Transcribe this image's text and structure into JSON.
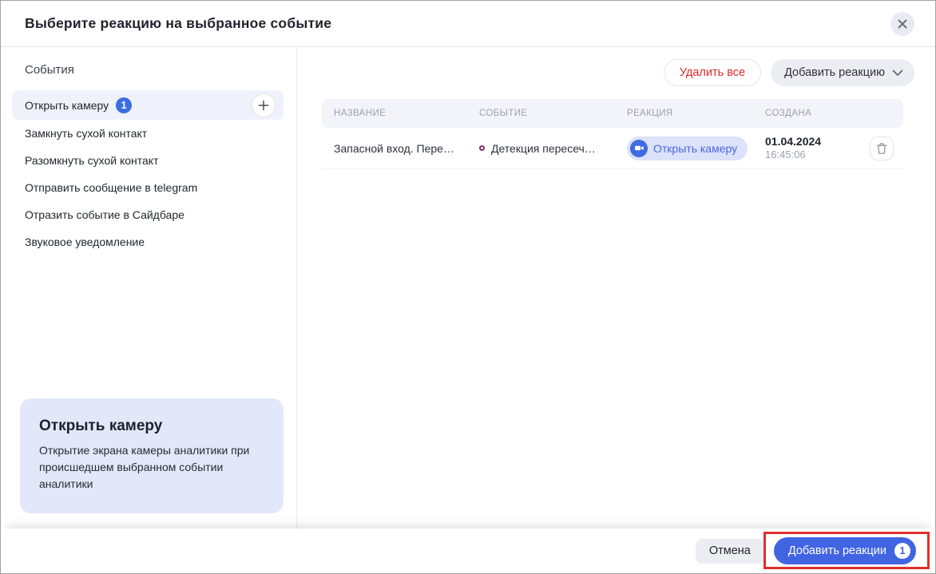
{
  "dialog": {
    "title": "Выберите реакцию на выбранное событие"
  },
  "sidebar": {
    "heading": "События",
    "items": [
      {
        "label": "Открыть камеру",
        "badge": "1",
        "selected": true
      },
      {
        "label": "Замкнуть сухой контакт"
      },
      {
        "label": "Разомкнуть сухой контакт"
      },
      {
        "label": "Отправить сообщение в telegram"
      },
      {
        "label": "Отразить событие в Сайдбаре"
      },
      {
        "label": "Звуковое уведомление"
      }
    ],
    "info_card": {
      "title": "Открыть камеру",
      "description": "Открытие экрана камеры аналитики при происшедшем выбранном событии аналитики"
    }
  },
  "main": {
    "delete_all_label": "Удалить все",
    "add_reaction_label": "Добавить реакцию",
    "table": {
      "headers": [
        "НАЗВАНИЕ",
        "СОБЫТИЕ",
        "РЕАКЦИЯ",
        "СОЗДАНА"
      ],
      "rows": [
        {
          "name": "Запасной вход. Пере…",
          "event": "Детекция пересеч…",
          "reaction": "Открыть камеру",
          "created_date": "01.04.2024",
          "created_time": "16:45:06"
        }
      ]
    }
  },
  "footer": {
    "cancel_label": "Отмена",
    "submit_label": "Добавить реакции",
    "submit_badge": "1"
  },
  "icons": {
    "close": "close-icon",
    "plus": "plus-icon",
    "chevron_down": "chevron-down-icon",
    "event_ring": "event-type-ring-icon",
    "camera": "camera-icon",
    "trash": "trash-icon"
  },
  "colors": {
    "accent_blue": "#4164e3",
    "badge_blue": "#3b6ee0",
    "pill_bg": "#dbe2f9",
    "pill_text": "#4b66e4",
    "danger_red": "#df2b2b",
    "annotation_red": "#e0302e",
    "selected_item_bg": "#eff2fa",
    "info_card_bg": "#e2e8f9",
    "table_header_bg": "#f3f4f9",
    "muted_text": "#9aa0ac",
    "event_ring": "#7d3069"
  }
}
